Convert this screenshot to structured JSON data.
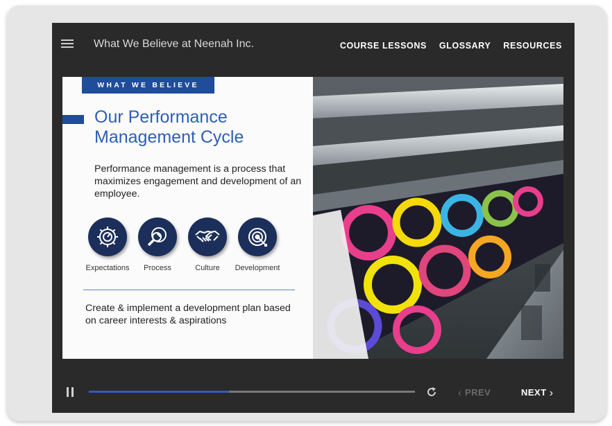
{
  "app": {
    "title": "What We Believe at Neenah Inc."
  },
  "nav": {
    "links": [
      "COURSE LESSONS",
      "GLOSSARY",
      "RESOURCES"
    ]
  },
  "slide": {
    "tag": "WHAT WE BELIEVE",
    "heading": "Our Performance Management Cycle",
    "body": "Performance management is a process that maximizes engagement and development of an employee.",
    "icons": [
      {
        "label": "Expectations",
        "icon": "gear-icon"
      },
      {
        "label": "Process",
        "icon": "magnifier-icon"
      },
      {
        "label": "Culture",
        "icon": "handshake-icon"
      },
      {
        "label": "Development",
        "icon": "target-icon"
      }
    ],
    "footer": "Create & implement a development plan based on career interests & aspirations",
    "colors": {
      "accent": "#1f4c9b",
      "heading": "#2d5fb5",
      "icon_bg": "#1c2f5a"
    }
  },
  "controls": {
    "progress": 0.43,
    "prev_label": "PREV",
    "next_label": "NEXT"
  }
}
